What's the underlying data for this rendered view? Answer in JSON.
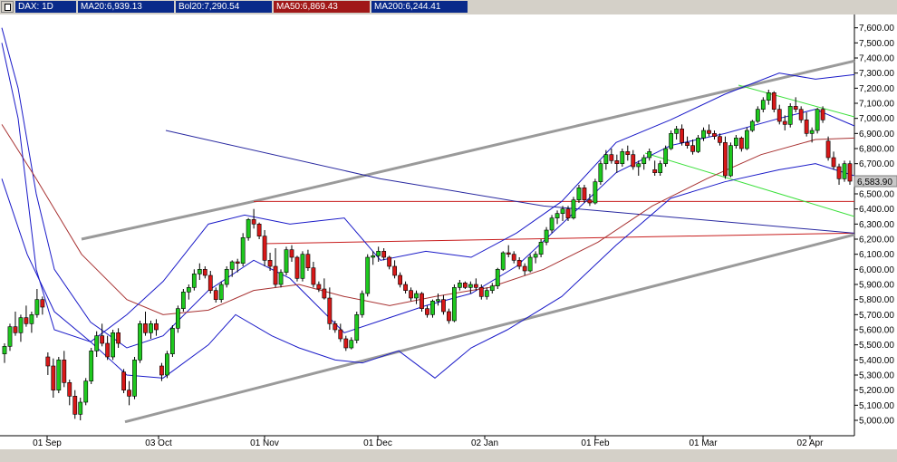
{
  "header": {
    "items": [
      {
        "text": "DAX: 1D",
        "color": "#0a2a8a"
      },
      {
        "text": "MA20:6,939.13",
        "color": "#0a2a8a"
      },
      {
        "text": "Bol20:7,290.54",
        "color": "#0a2a8a"
      },
      {
        "text": "MA50:6,869.43",
        "color": "#a01818"
      },
      {
        "text": "MA200:6,244.41",
        "color": "#0a2a8a"
      }
    ]
  },
  "chart_data": {
    "type": "candlestick",
    "title": "",
    "xlabel": "",
    "ylabel": "",
    "ylim": [
      4900,
      7700
    ],
    "grid": false,
    "y_ticks": [
      "7,600.00",
      "7,500.00",
      "7,400.00",
      "7,300.00",
      "7,200.00",
      "7,100.00",
      "7,000.00",
      "6,900.00",
      "6,800.00",
      "6,700.00",
      "6,600.00",
      "6,500.00",
      "6,400.00",
      "6,300.00",
      "6,200.00",
      "6,100.00",
      "6,000.00",
      "5,900.00",
      "5,800.00",
      "5,700.00",
      "5,600.00",
      "5,500.00",
      "5,400.00",
      "5,300.00",
      "5,200.00",
      "5,100.00",
      "5,000.00"
    ],
    "x_ticks": [
      "01 Sep",
      "03 Oct",
      "01 Nov",
      "01 Dec",
      "02 Jan",
      "01 Feb",
      "01 Mar",
      "02 Apr"
    ],
    "last_price": "6,583.90",
    "colors": {
      "up": "#1ec81e",
      "down": "#d81818",
      "ma_blue": "#1a1ac8",
      "ma_red": "#a83232",
      "trend_gray": "#9a9a9a",
      "horizontal": "#c81e1e",
      "channel_green": "#3ce03c",
      "long_blue": "#2828a0"
    },
    "candles": [
      [
        5440,
        5510,
        5380,
        5490
      ],
      [
        5490,
        5640,
        5460,
        5620
      ],
      [
        5620,
        5720,
        5560,
        5580
      ],
      [
        5580,
        5700,
        5520,
        5680
      ],
      [
        5680,
        5760,
        5620,
        5640
      ],
      [
        5640,
        5720,
        5580,
        5700
      ],
      [
        5700,
        5870,
        5680,
        5800
      ],
      [
        5800,
        5820,
        5700,
        5750
      ],
      [
        5420,
        5450,
        5300,
        5360
      ],
      [
        5360,
        5410,
        5150,
        5200
      ],
      [
        5200,
        5420,
        5180,
        5400
      ],
      [
        5400,
        5460,
        5220,
        5250
      ],
      [
        5250,
        5270,
        5100,
        5160
      ],
      [
        5160,
        5200,
        5010,
        5040
      ],
      [
        5040,
        5150,
        5000,
        5120
      ],
      [
        5120,
        5280,
        5100,
        5260
      ],
      [
        5260,
        5480,
        5240,
        5460
      ],
      [
        5460,
        5590,
        5420,
        5560
      ],
      [
        5560,
        5640,
        5490,
        5510
      ],
      [
        5510,
        5560,
        5400,
        5420
      ],
      [
        5420,
        5600,
        5400,
        5580
      ],
      [
        5580,
        5610,
        5480,
        5510
      ],
      [
        5320,
        5340,
        5180,
        5200
      ],
      [
        5200,
        5260,
        5100,
        5160
      ],
      [
        5160,
        5420,
        5140,
        5400
      ],
      [
        5400,
        5660,
        5380,
        5640
      ],
      [
        5640,
        5720,
        5560,
        5580
      ],
      [
        5580,
        5660,
        5540,
        5640
      ],
      [
        5640,
        5670,
        5560,
        5600
      ],
      [
        5360,
        5380,
        5260,
        5300
      ],
      [
        5300,
        5460,
        5280,
        5440
      ],
      [
        5440,
        5630,
        5420,
        5610
      ],
      [
        5610,
        5760,
        5580,
        5740
      ],
      [
        5740,
        5870,
        5720,
        5850
      ],
      [
        5850,
        5900,
        5800,
        5880
      ],
      [
        5880,
        6000,
        5860,
        5970
      ],
      [
        5970,
        6040,
        5930,
        6000
      ],
      [
        6000,
        6020,
        5940,
        5960
      ],
      [
        5960,
        5990,
        5840,
        5860
      ],
      [
        5860,
        5880,
        5780,
        5800
      ],
      [
        5800,
        5920,
        5780,
        5900
      ],
      [
        5900,
        6020,
        5880,
        6000
      ],
      [
        6000,
        6060,
        5950,
        6050
      ],
      [
        6050,
        6070,
        5980,
        6040
      ],
      [
        6040,
        6240,
        6020,
        6210
      ],
      [
        6210,
        6340,
        6190,
        6330
      ],
      [
        6330,
        6400,
        6270,
        6300
      ],
      [
        6300,
        6310,
        6200,
        6220
      ],
      [
        6220,
        6260,
        6020,
        6060
      ],
      [
        6060,
        6110,
        5990,
        6020
      ],
      [
        6020,
        6140,
        5880,
        5900
      ],
      [
        5900,
        6000,
        5880,
        5980
      ],
      [
        5980,
        6150,
        5960,
        6130
      ],
      [
        6130,
        6160,
        6050,
        6080
      ],
      [
        6080,
        6090,
        5920,
        5940
      ],
      [
        5940,
        6120,
        5920,
        6100
      ],
      [
        6100,
        6130,
        5990,
        6010
      ],
      [
        6010,
        6050,
        5880,
        5900
      ],
      [
        5900,
        5920,
        5850,
        5870
      ],
      [
        5870,
        5940,
        5800,
        5810
      ],
      [
        5810,
        5880,
        5600,
        5640
      ],
      [
        5640,
        5660,
        5580,
        5600
      ],
      [
        5600,
        5640,
        5520,
        5540
      ],
      [
        5540,
        5560,
        5460,
        5480
      ],
      [
        5480,
        5550,
        5470,
        5530
      ],
      [
        5530,
        5720,
        5510,
        5700
      ],
      [
        5700,
        5860,
        5680,
        5840
      ],
      [
        5840,
        6100,
        5820,
        6080
      ],
      [
        6080,
        6120,
        6030,
        6090
      ],
      [
        6090,
        6150,
        6050,
        6120
      ],
      [
        6120,
        6140,
        6060,
        6080
      ],
      [
        6080,
        6090,
        6000,
        6020
      ],
      [
        6020,
        6060,
        5940,
        5960
      ],
      [
        5960,
        5980,
        5880,
        5900
      ],
      [
        5900,
        5920,
        5840,
        5860
      ],
      [
        5860,
        5880,
        5790,
        5810
      ],
      [
        5810,
        5860,
        5770,
        5840
      ],
      [
        5840,
        5850,
        5720,
        5740
      ],
      [
        5740,
        5760,
        5680,
        5700
      ],
      [
        5700,
        5800,
        5680,
        5790
      ],
      [
        5790,
        5840,
        5760,
        5800
      ],
      [
        5800,
        5830,
        5700,
        5720
      ],
      [
        5720,
        5740,
        5640,
        5660
      ],
      [
        5660,
        5900,
        5650,
        5880
      ],
      [
        5880,
        5930,
        5860,
        5910
      ],
      [
        5910,
        5920,
        5870,
        5880
      ],
      [
        5880,
        5920,
        5840,
        5900
      ],
      [
        5900,
        5940,
        5860,
        5880
      ],
      [
        5880,
        5900,
        5800,
        5820
      ],
      [
        5820,
        5880,
        5800,
        5860
      ],
      [
        5860,
        5910,
        5840,
        5890
      ],
      [
        5890,
        6010,
        5870,
        6000
      ],
      [
        6000,
        6120,
        5990,
        6110
      ],
      [
        6110,
        6160,
        6080,
        6100
      ],
      [
        6100,
        6120,
        6040,
        6060
      ],
      [
        6060,
        6080,
        6000,
        6020
      ],
      [
        6020,
        6040,
        5960,
        5990
      ],
      [
        5990,
        6100,
        5980,
        6080
      ],
      [
        6080,
        6120,
        6040,
        6100
      ],
      [
        6100,
        6200,
        6080,
        6180
      ],
      [
        6180,
        6280,
        6160,
        6260
      ],
      [
        6260,
        6360,
        6240,
        6340
      ],
      [
        6340,
        6390,
        6300,
        6370
      ],
      [
        6370,
        6420,
        6320,
        6400
      ],
      [
        6400,
        6420,
        6320,
        6340
      ],
      [
        6340,
        6480,
        6330,
        6460
      ],
      [
        6460,
        6560,
        6440,
        6540
      ],
      [
        6540,
        6560,
        6440,
        6460
      ],
      [
        6460,
        6500,
        6420,
        6440
      ],
      [
        6440,
        6600,
        6430,
        6580
      ],
      [
        6580,
        6720,
        6560,
        6700
      ],
      [
        6700,
        6790,
        6660,
        6760
      ],
      [
        6760,
        6800,
        6700,
        6720
      ],
      [
        6720,
        6760,
        6640,
        6700
      ],
      [
        6700,
        6800,
        6680,
        6780
      ],
      [
        6780,
        6820,
        6720,
        6760
      ],
      [
        6760,
        6790,
        6660,
        6680
      ],
      [
        6680,
        6720,
        6620,
        6700
      ],
      [
        6700,
        6760,
        6660,
        6740
      ],
      [
        6740,
        6800,
        6720,
        6780
      ],
      [
        6660,
        6720,
        6620,
        6640
      ],
      [
        6640,
        6720,
        6620,
        6700
      ],
      [
        6700,
        6820,
        6680,
        6800
      ],
      [
        6800,
        6920,
        6790,
        6900
      ],
      [
        6900,
        6950,
        6860,
        6930
      ],
      [
        6930,
        6960,
        6820,
        6840
      ],
      [
        6840,
        6880,
        6800,
        6820
      ],
      [
        6820,
        6860,
        6760,
        6780
      ],
      [
        6780,
        6890,
        6770,
        6870
      ],
      [
        6870,
        6940,
        6850,
        6920
      ],
      [
        6920,
        6960,
        6880,
        6900
      ],
      [
        6900,
        6920,
        6860,
        6880
      ],
      [
        6880,
        6900,
        6820,
        6840
      ],
      [
        6840,
        6880,
        6600,
        6620
      ],
      [
        6620,
        6840,
        6610,
        6820
      ],
      [
        6820,
        6890,
        6800,
        6870
      ],
      [
        6870,
        6880,
        6780,
        6800
      ],
      [
        6800,
        6940,
        6790,
        6920
      ],
      [
        6920,
        6990,
        6910,
        6980
      ],
      [
        6980,
        7080,
        6970,
        7060
      ],
      [
        7060,
        7140,
        7040,
        7120
      ],
      [
        7120,
        7190,
        7090,
        7170
      ],
      [
        7170,
        7180,
        7040,
        7060
      ],
      [
        7060,
        7090,
        6960,
        6980
      ],
      [
        6980,
        7020,
        6920,
        6960
      ],
      [
        6960,
        7100,
        6940,
        7080
      ],
      [
        7080,
        7140,
        7040,
        7060
      ],
      [
        7060,
        7080,
        6970,
        6990
      ],
      [
        6990,
        7040,
        6880,
        6900
      ],
      [
        6900,
        6940,
        6840,
        6920
      ],
      [
        6920,
        7070,
        6900,
        7060
      ],
      [
        7060,
        7080,
        6970,
        6990
      ],
      [
        6850,
        6880,
        6720,
        6740
      ],
      [
        6740,
        6780,
        6660,
        6680
      ],
      [
        6680,
        6700,
        6560,
        6600
      ],
      [
        6600,
        6720,
        6580,
        6700
      ],
      [
        6700,
        6720,
        6560,
        6584
      ]
    ]
  }
}
